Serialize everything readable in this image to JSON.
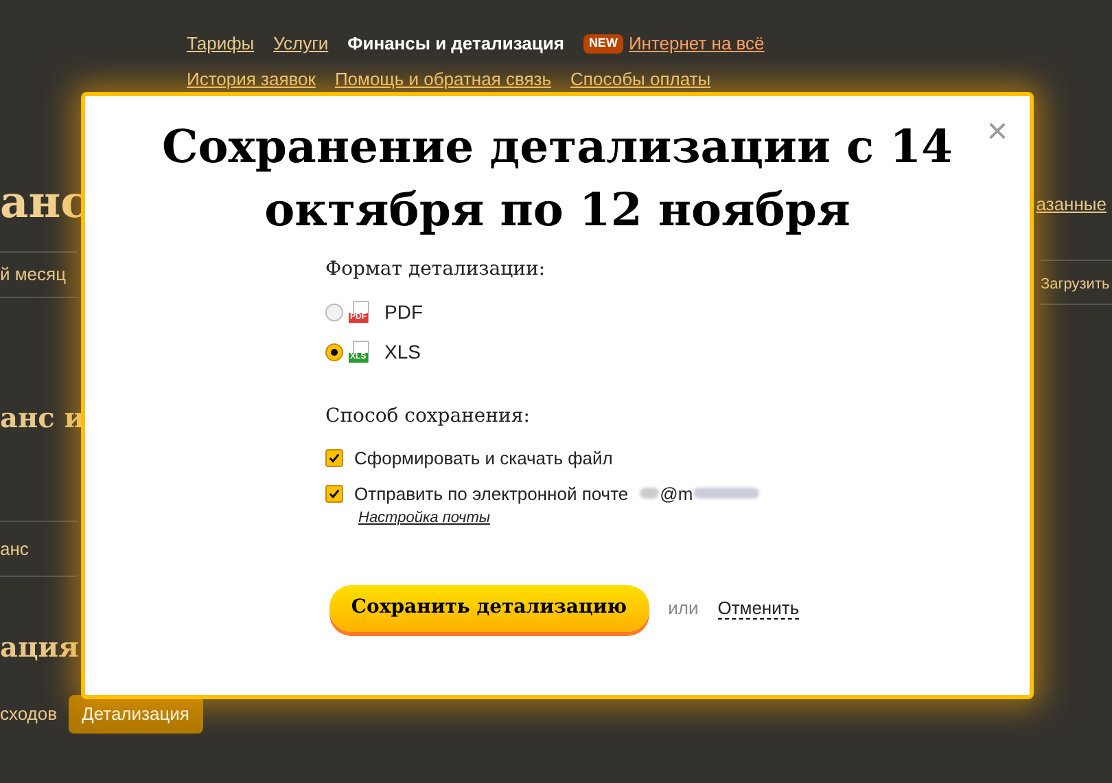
{
  "nav": {
    "items": [
      {
        "label": "Тарифы",
        "selected": false
      },
      {
        "label": "Услуги",
        "selected": false
      },
      {
        "label": "Финансы и детализация",
        "selected": true
      }
    ],
    "badge": "NEW",
    "promo_link": "Интернет на всё",
    "subitems": [
      "История заявок",
      "Помощь и обратная связь",
      "Способы оплаты"
    ]
  },
  "page": {
    "heading": "анс",
    "period": "й месяц",
    "right_link": "азанные",
    "right_button": "Загрузить",
    "section_1": "анс и",
    "row": "анс",
    "section_2": "ация",
    "tabs": [
      {
        "label": "сходов",
        "selected": false
      },
      {
        "label": "Детализация",
        "selected": true
      }
    ]
  },
  "dialog": {
    "title": "Сохранение детализации с 14 октября по 12 ноября",
    "close": "×",
    "format_label": "Формат детализации:",
    "formats": [
      {
        "kind": "pdf",
        "badge": "PDF",
        "label": "PDF",
        "selected": false
      },
      {
        "kind": "xls",
        "badge": "XLS",
        "label": "XLS",
        "selected": true
      }
    ],
    "method_label": "Способ сохранения:",
    "methods": [
      {
        "label": "Сформировать и скачать файл",
        "checked": true
      },
      {
        "label": "Отправить по электронной почте",
        "email_visible": "@m",
        "checked": true,
        "link": "Настройка почты"
      }
    ],
    "save_button": "Сохранить детализацию",
    "or": "или",
    "cancel": "Отменить"
  }
}
